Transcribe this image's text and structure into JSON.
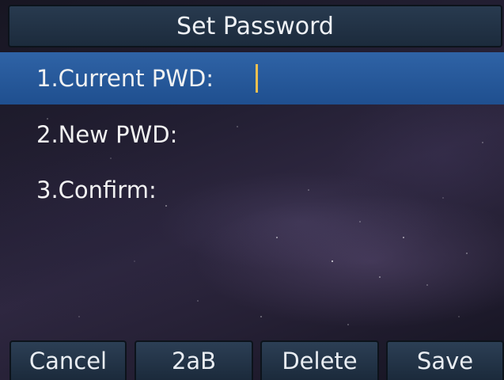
{
  "header": {
    "title": "Set Password"
  },
  "fields": [
    {
      "label": "1.Current PWD:",
      "value": "",
      "selected": true
    },
    {
      "label": "2.New PWD:",
      "value": "",
      "selected": false
    },
    {
      "label": "3.Confirm:",
      "value": "",
      "selected": false
    }
  ],
  "softkeys": {
    "cancel": "Cancel",
    "input_mode": "2aB",
    "delete": "Delete",
    "save": "Save"
  },
  "colors": {
    "selection": "#2f63a6",
    "cursor": "#f0c050",
    "title_bar": "#283a4f"
  }
}
